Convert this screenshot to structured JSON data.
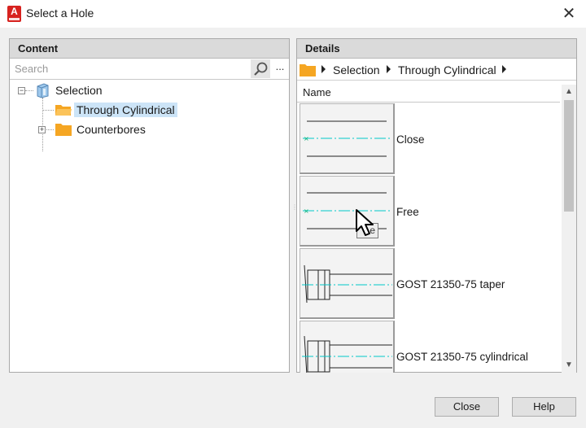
{
  "window": {
    "title": "Select a Hole",
    "app_icon_letter": "A"
  },
  "content_panel": {
    "header": "Content",
    "search": {
      "placeholder": "Search",
      "value": "",
      "more_label": "..."
    },
    "tree": {
      "root": {
        "label": "Selection",
        "expander": "−"
      },
      "children": [
        {
          "label": "Through Cylindrical",
          "selected": true
        },
        {
          "label": "Counterbores",
          "expander": "+"
        }
      ]
    }
  },
  "details_panel": {
    "header": "Details",
    "breadcrumb": [
      "Selection",
      "Through Cylindrical"
    ],
    "column_header": "Name",
    "items": [
      {
        "label": "Close",
        "thumbnail": "through-hole-close"
      },
      {
        "label": "Free",
        "thumbnail": "through-hole-free"
      },
      {
        "label": "GOST 21350-75 taper",
        "thumbnail": "taper-hole"
      },
      {
        "label": "GOST 21350-75 cylindrical",
        "thumbnail": "cylindrical-hole"
      }
    ]
  },
  "tooltip_fragment": "e",
  "buttons": {
    "close": "Close",
    "help": "Help"
  },
  "colors": {
    "accent_selected": "#cce4f7",
    "folder": "#f5a623",
    "centerline": "#00c8c8",
    "app_icon": "#d7221f"
  }
}
